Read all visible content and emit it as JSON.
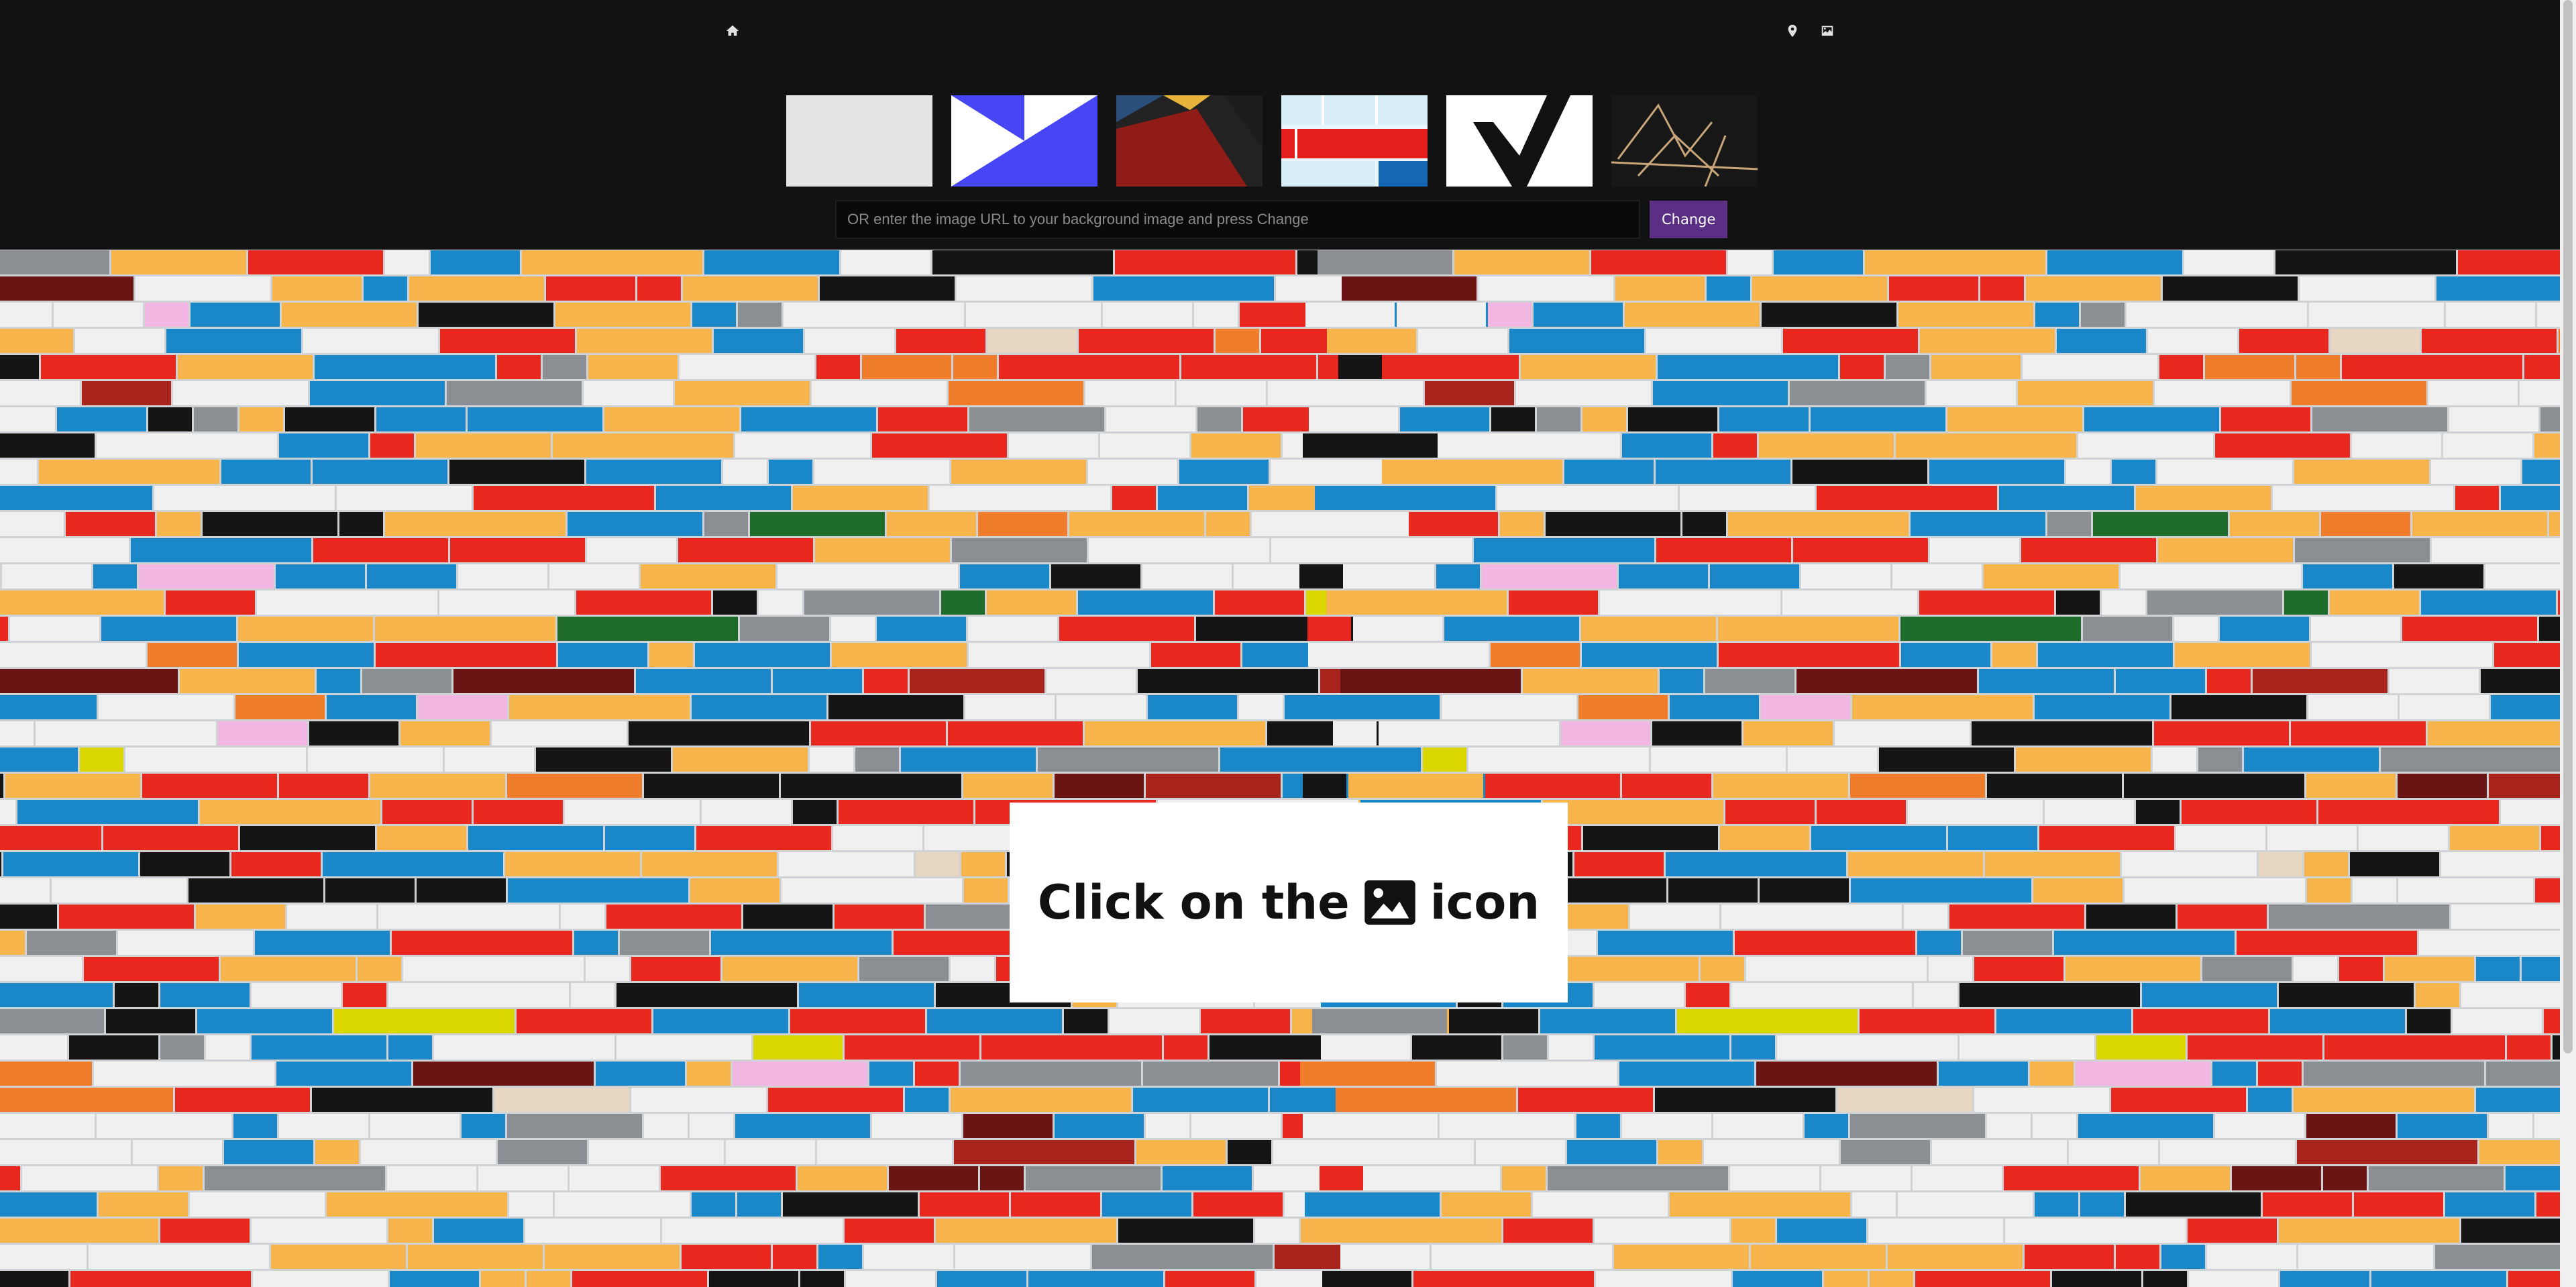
{
  "nav": {
    "home_icon": "home-icon",
    "location_icon": "map-pin-icon",
    "image_icon": "image-icon"
  },
  "thumbnails": [
    {
      "name": "light-gray"
    },
    {
      "name": "blue-white-geometric"
    },
    {
      "name": "dark-red-triangles"
    },
    {
      "name": "red-blue-stripes"
    },
    {
      "name": "white-chevron"
    },
    {
      "name": "dark-wire-structure"
    }
  ],
  "url_form": {
    "placeholder": "OR enter the image URL to your background image and press Change",
    "value": "",
    "button_label": "Change"
  },
  "card": {
    "text_before": "Click on the",
    "icon": "image-icon",
    "text_after": "icon"
  },
  "colors": {
    "topbar": "#121212",
    "button": "#5a2f84",
    "bricks": [
      "#f0f0f0",
      "#1a87c9",
      "#e8281e",
      "#f7b44a",
      "#141414",
      "#8b8f93",
      "#d9d600",
      "#f2b6e2",
      "#f07d2c",
      "#6b1414",
      "#1f6c2a",
      "#e7d7c2",
      "#a8231b"
    ]
  }
}
